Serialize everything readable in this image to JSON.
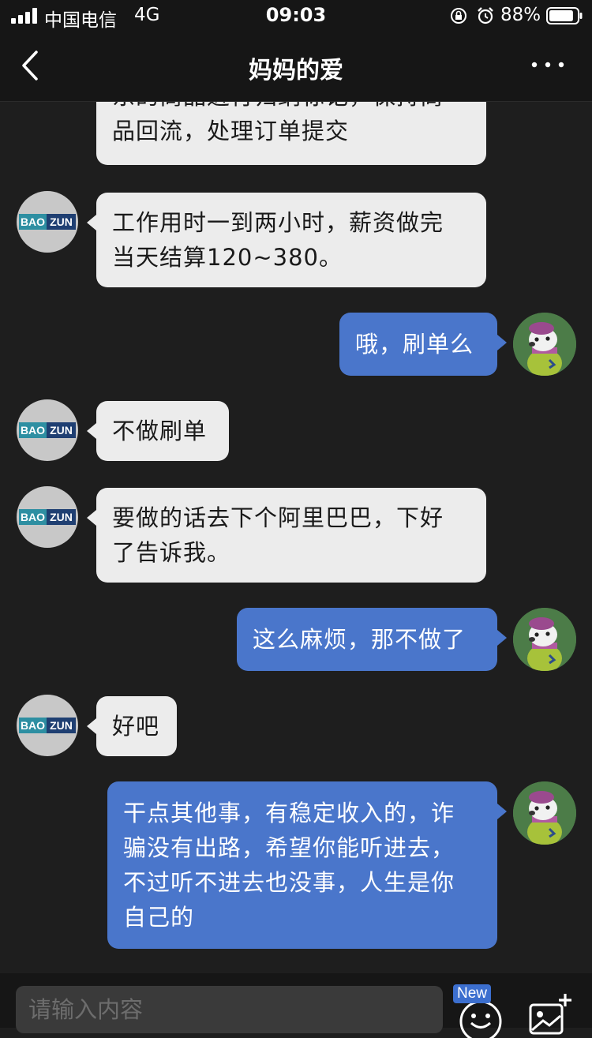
{
  "status_bar": {
    "carrier": "中国电信",
    "network": "4G",
    "time": "09:03",
    "battery": "88%",
    "battery_level": 0.88
  },
  "nav": {
    "title": "妈妈的爱",
    "back_icon": "chevron-left-icon",
    "more_icon": "more-horizontal-icon"
  },
  "messages": [
    {
      "side": "in",
      "text": "东的商品进行归纳标记，保持商品回流，处理订单提交",
      "lines": [
        "东的商品进行归纳标记，保持商",
        "品回流，处理订单提交"
      ]
    },
    {
      "side": "in",
      "text": "工作用时一到两小时，薪资做完当天结算120~380。",
      "lines": [
        "工作用时一到两小时，薪资做完",
        "当天结算120~380。"
      ],
      "avatar": "BAO ZUN"
    },
    {
      "side": "out",
      "text": "哦，刷单么"
    },
    {
      "side": "in",
      "text": "不做刷单",
      "avatar": "BAO ZUN"
    },
    {
      "side": "in",
      "text": "要做的话去下个阿里巴巴，下好了告诉我。",
      "lines": [
        "要做的话去下个阿里巴巴，下好",
        "了告诉我。"
      ],
      "avatar": "BAO ZUN"
    },
    {
      "side": "out",
      "text": "这么麻烦，那不做了"
    },
    {
      "side": "in",
      "text": "好吧",
      "avatar": "BAO ZUN"
    },
    {
      "side": "out",
      "text": "干点其他事，有稳定收入的，诈骗没有出路，希望你能听进去，不过听不进去也没事，人生是你自己的",
      "lines": [
        "干点其他事，有稳定收入的，诈",
        "骗没有出路，希望你能听进去，",
        "不过听不进去也没事，人生是你",
        "自己的"
      ]
    }
  ],
  "avatar_logo": {
    "left": "BAO",
    "right": "ZUN"
  },
  "input": {
    "placeholder": "请输入内容",
    "new_badge": "New",
    "emoji_icon": "emoji-icon",
    "image_icon": "add-image-icon"
  },
  "colors": {
    "background": "#1e1e1e",
    "incoming_bubble": "#ececec",
    "outgoing_bubble": "#4a76cb",
    "badge": "#3c6fcf"
  }
}
